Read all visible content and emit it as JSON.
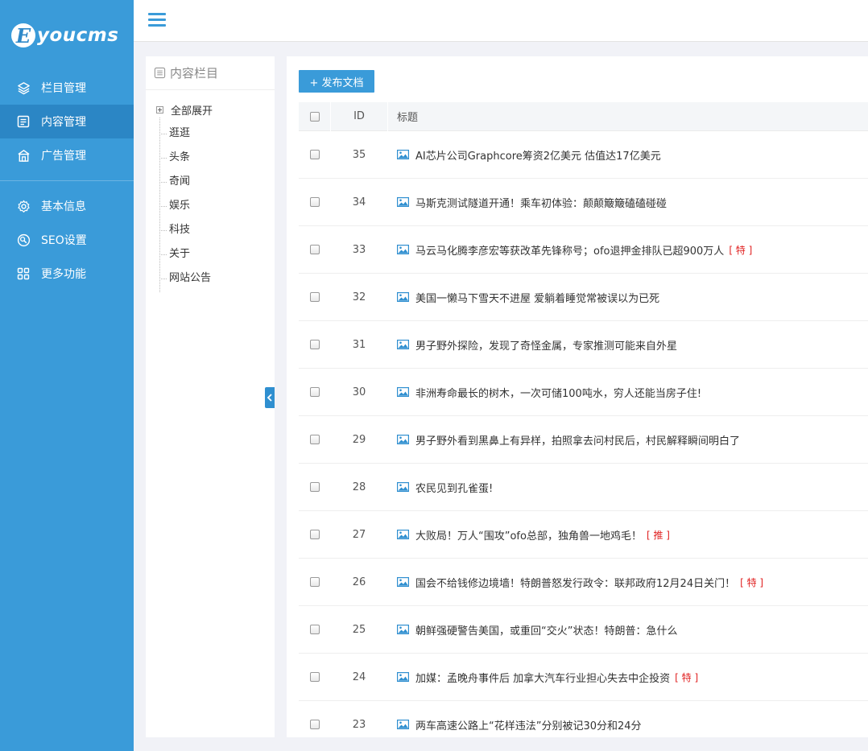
{
  "logo": {
    "letter": "E",
    "text": "youcms"
  },
  "sidebar": {
    "items": [
      {
        "label": "栏目管理",
        "icon": "layers-icon",
        "active": false
      },
      {
        "label": "内容管理",
        "icon": "document-icon",
        "active": true
      },
      {
        "label": "广告管理",
        "icon": "ad-icon",
        "active": false
      }
    ],
    "items2": [
      {
        "label": "基本信息",
        "icon": "gear-icon"
      },
      {
        "label": "SEO设置",
        "icon": "seo-icon"
      },
      {
        "label": "更多功能",
        "icon": "grid-icon"
      }
    ]
  },
  "tree": {
    "title": "内容栏目",
    "expand_all": "全部展开",
    "nodes": [
      "逛逛",
      "头条",
      "奇闻",
      "娱乐",
      "科技",
      "关于",
      "网站公告"
    ]
  },
  "toolbar": {
    "publish_label": "+ 发布文档"
  },
  "table": {
    "headers": {
      "id": "ID",
      "title": "标题"
    },
    "rows": [
      {
        "id": "35",
        "title": "AI芯片公司Graphcore筹资2亿美元 估值达17亿美元",
        "tag": ""
      },
      {
        "id": "34",
        "title": "马斯克测试隧道开通！乘车初体验：颠颠簸簸磕磕碰碰",
        "tag": ""
      },
      {
        "id": "33",
        "title": "马云马化腾李彦宏等获改革先锋称号；ofo退押金排队已超900万人",
        "tag": "[ 特 ]"
      },
      {
        "id": "32",
        "title": "美国一懒马下雪天不进屋 爱躺着睡觉常被误以为已死",
        "tag": ""
      },
      {
        "id": "31",
        "title": "男子野外探险，发现了奇怪金属，专家推测可能来自外星",
        "tag": ""
      },
      {
        "id": "30",
        "title": "非洲寿命最长的树木，一次可储100吨水，穷人还能当房子住!",
        "tag": ""
      },
      {
        "id": "29",
        "title": "男子野外看到黑鼻上有异样，拍照拿去问村民后，村民解释瞬间明白了",
        "tag": ""
      },
      {
        "id": "28",
        "title": "农民见到孔雀蛋!",
        "tag": ""
      },
      {
        "id": "27",
        "title": "大败局！万人“围攻”ofo总部，独角兽一地鸡毛！",
        "tag": "[ 推 ]"
      },
      {
        "id": "26",
        "title": "国会不给钱修边境墙！特朗普怒发行政令：联邦政府12月24日关门！",
        "tag": "[ 特 ]"
      },
      {
        "id": "25",
        "title": "朝鲜强硬警告美国，或重回“交火”状态！特朗普：急什么",
        "tag": ""
      },
      {
        "id": "24",
        "title": "加媒：孟晚舟事件后 加拿大汽车行业担心失去中企投资",
        "tag": "[ 特 ]"
      },
      {
        "id": "23",
        "title": "两车高速公路上“花样违法”分别被记30分和24分",
        "tag": ""
      }
    ]
  }
}
